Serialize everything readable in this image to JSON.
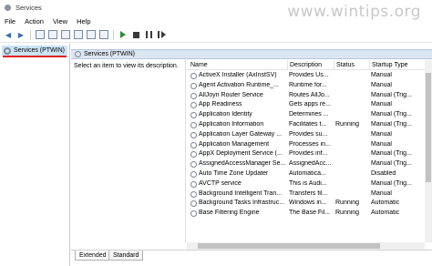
{
  "window": {
    "title": "Services"
  },
  "watermark": "www.wintips.org",
  "menu": [
    "File",
    "Action",
    "View",
    "Help"
  ],
  "tree": {
    "selected_label": "Services (PTWIN)"
  },
  "main": {
    "header_title": "Services (PTWIN)",
    "description_prompt": "Select an item to view its description."
  },
  "columns": {
    "name": "Name",
    "description": "Description",
    "status": "Status",
    "startup": "Startup Type"
  },
  "services": [
    {
      "name": "ActiveX Installer (AxInstSV)",
      "description": "Provides Us...",
      "status": "",
      "startup": "Manual"
    },
    {
      "name": "Agent Activation Runtime_...",
      "description": "Runtime for...",
      "status": "",
      "startup": "Manual"
    },
    {
      "name": "AllJoyn Router Service",
      "description": "Routes AllJo...",
      "status": "",
      "startup": "Manual (Trig..."
    },
    {
      "name": "App Readiness",
      "description": "Gets apps re...",
      "status": "",
      "startup": "Manual"
    },
    {
      "name": "Application Identity",
      "description": "Determines ...",
      "status": "",
      "startup": "Manual (Trig..."
    },
    {
      "name": "Application Information",
      "description": "Facilitates t...",
      "status": "Running",
      "startup": "Manual (Trig..."
    },
    {
      "name": "Application Layer Gateway ...",
      "description": "Provides su...",
      "status": "",
      "startup": "Manual"
    },
    {
      "name": "Application Management",
      "description": "Processes in...",
      "status": "",
      "startup": "Manual"
    },
    {
      "name": "AppX Deployment Service (...",
      "description": "Provides inf...",
      "status": "",
      "startup": "Manual (Trig..."
    },
    {
      "name": "AssignedAccessManager Se...",
      "description": "AssignedAcc...",
      "status": "",
      "startup": "Manual (Trig..."
    },
    {
      "name": "Auto Time Zone Updater",
      "description": "Automatica...",
      "status": "",
      "startup": "Disabled"
    },
    {
      "name": "AVCTP service",
      "description": "This is Audi...",
      "status": "",
      "startup": "Manual (Trig..."
    },
    {
      "name": "Background Intelligent Tran...",
      "description": "Transfers fil...",
      "status": "",
      "startup": "Manual"
    },
    {
      "name": "Background Tasks Infrastruc...",
      "description": "Windows in...",
      "status": "Running",
      "startup": "Automatic"
    },
    {
      "name": "Base Filtering Engine",
      "description": "The Base Fil...",
      "status": "Running",
      "startup": "Automatic"
    }
  ],
  "tabs": [
    "Extended",
    "Standard"
  ]
}
